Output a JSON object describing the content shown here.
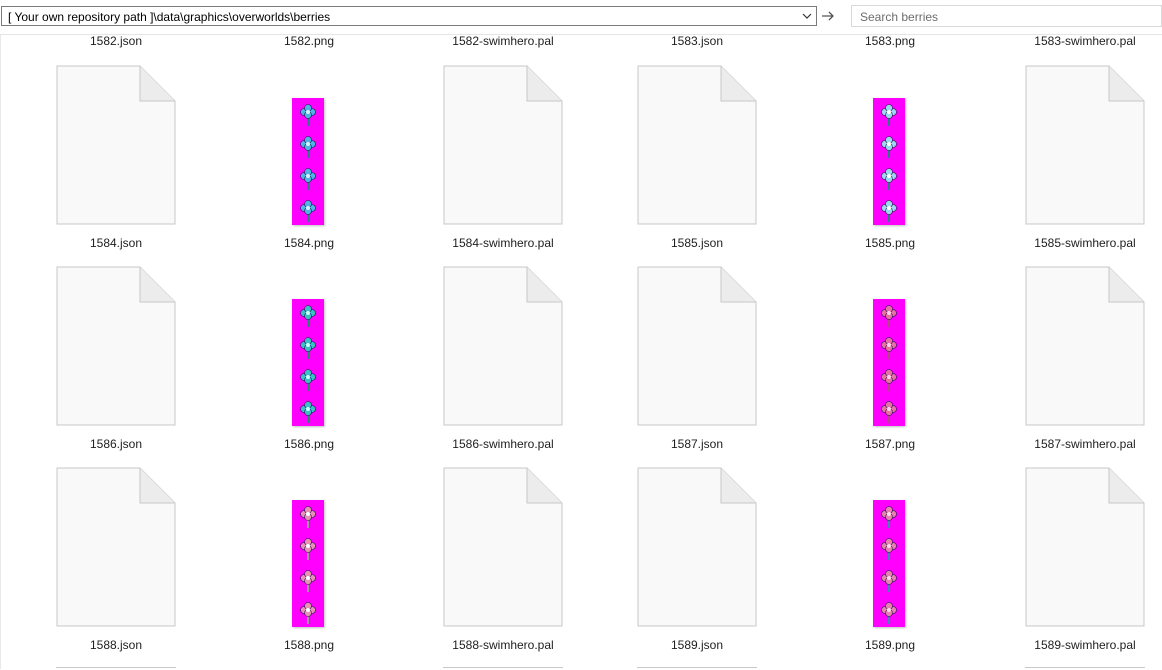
{
  "address_bar": {
    "path": "[ Your own repository path ]\\data\\graphics\\overworlds\\berries",
    "dropdown_icon": "chevron-down-icon",
    "go_icon": "arrow-right-icon"
  },
  "search": {
    "placeholder": "Search berries",
    "icon": "search-icon"
  },
  "partial_row": [
    "1582.json",
    "1582.png",
    "1582-swimhero.pal",
    "1583.json",
    "1583.png",
    "1583-swimhero.pal"
  ],
  "rows": [
    {
      "files": [
        {
          "name": "1584.json",
          "kind": "json"
        },
        {
          "name": "1584.png",
          "kind": "png",
          "sprite": "blue-flower"
        },
        {
          "name": "1584-swimhero.pal",
          "kind": "pal"
        },
        {
          "name": "1585.json",
          "kind": "json"
        },
        {
          "name": "1585.png",
          "kind": "png",
          "sprite": "white-blue-flower"
        },
        {
          "name": "1585-swimhero.pal",
          "kind": "pal"
        }
      ]
    },
    {
      "files": [
        {
          "name": "1586.json",
          "kind": "json"
        },
        {
          "name": "1586.png",
          "kind": "png",
          "sprite": "teal-flower"
        },
        {
          "name": "1586-swimhero.pal",
          "kind": "pal"
        },
        {
          "name": "1587.json",
          "kind": "json"
        },
        {
          "name": "1587.png",
          "kind": "png",
          "sprite": "pink-flower"
        },
        {
          "name": "1587-swimhero.pal",
          "kind": "pal"
        }
      ]
    },
    {
      "files": [
        {
          "name": "1588.json",
          "kind": "json"
        },
        {
          "name": "1588.png",
          "kind": "png",
          "sprite": "pink-white-flower"
        },
        {
          "name": "1588-swimhero.pal",
          "kind": "pal"
        },
        {
          "name": "1589.json",
          "kind": "json"
        },
        {
          "name": "1589.png",
          "kind": "png",
          "sprite": "pink-blue-flower"
        },
        {
          "name": "1589-swimhero.pal",
          "kind": "pal"
        }
      ]
    }
  ],
  "colors": {
    "sprite_background": "#ff00ff",
    "doc_fill": "#f9f9f9",
    "doc_border": "#c8c8c8",
    "label_text": "#1e1e1e"
  }
}
